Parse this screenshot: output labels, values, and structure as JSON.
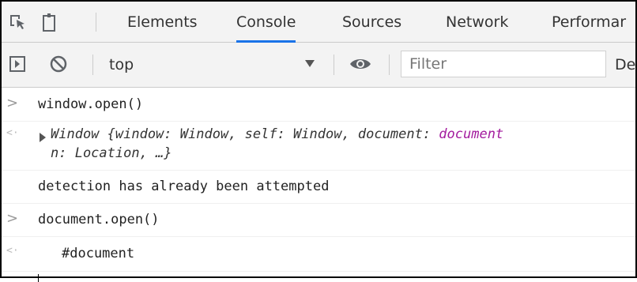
{
  "tabbar": {
    "tabs": [
      {
        "label": "Elements",
        "active": false
      },
      {
        "label": "Console",
        "active": true
      },
      {
        "label": "Sources",
        "active": false
      },
      {
        "label": "Network",
        "active": false
      },
      {
        "label": "Performar",
        "active": false
      }
    ],
    "accent_color": "#1a73e8"
  },
  "toolbar": {
    "context": "top",
    "filter_placeholder": "Filter",
    "levels_label": "De"
  },
  "console": {
    "entries": [
      {
        "kind": "input",
        "text": "window.open()"
      },
      {
        "kind": "result",
        "part1": "Window {window: Window, self: Window, document: ",
        "part2": "document",
        "line2": "n: Location, …}"
      },
      {
        "kind": "log",
        "text": "detection has already been attempted"
      },
      {
        "kind": "input",
        "text": "document.open()"
      },
      {
        "kind": "result",
        "text": "#document"
      }
    ]
  }
}
